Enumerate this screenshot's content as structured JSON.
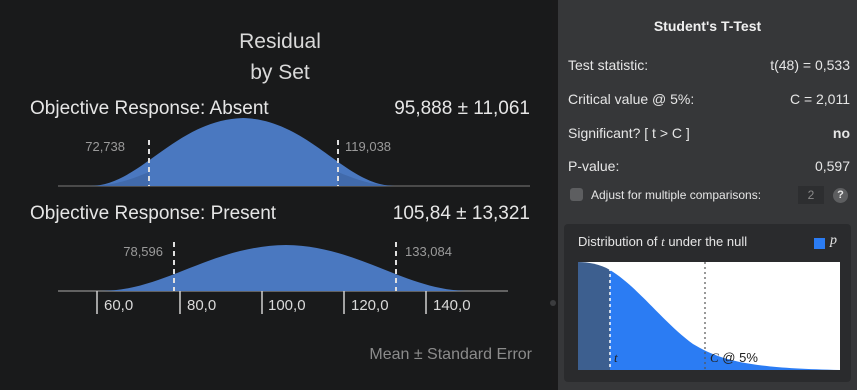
{
  "left": {
    "title_line1": "Residual",
    "title_line2": "by Set",
    "groups": [
      {
        "label": "Objective Response: Absent",
        "value": "95,888 ± 11,061",
        "ci_low": "72,738",
        "ci_high": "119,038"
      },
      {
        "label": "Objective Response: Present",
        "value": "105,84 ± 13,321",
        "ci_low": "78,596",
        "ci_high": "133,084"
      }
    ],
    "axis_ticks": [
      "60,0",
      "80,0",
      "100,0",
      "120,0",
      "140,0"
    ],
    "footer": "Mean ± Standard Error",
    "curve_color": "#4a78c0"
  },
  "ttest": {
    "title": "Student's T-Test",
    "rows": [
      {
        "label": "Test statistic:",
        "value": "t(48) = 0,533"
      },
      {
        "label": "Critical value @ 5%:",
        "value": "C = 2,011"
      },
      {
        "label": "Significant? [ t > C ]",
        "value": "no"
      },
      {
        "label": "P-value:",
        "value": "0,597"
      }
    ],
    "adjust_label": "Adjust for multiple comparisons:",
    "adjust_checked": false,
    "comparisons_value": "2",
    "help_label": "?",
    "distribution": {
      "title_prefix": "Distribution of ",
      "title_var": "t",
      "title_suffix": " under the null",
      "legend": "p",
      "t_label": "t",
      "c_label_var": "C",
      "c_label_suffix": " @ 5%",
      "fill_color": "#2b7cf3"
    }
  }
}
